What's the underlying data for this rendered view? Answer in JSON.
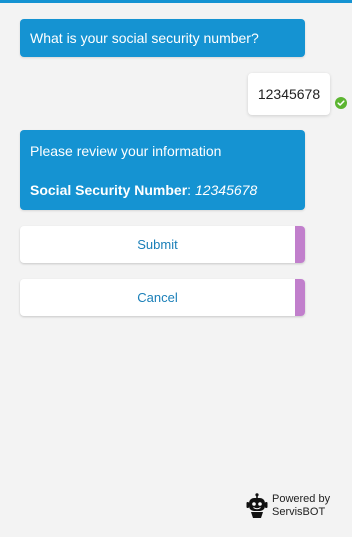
{
  "chat": {
    "bot_question": "What is your social security number?",
    "user_reply": "12345678",
    "review": {
      "title": "Please review your information",
      "field_label": "Social Security Number",
      "field_separator": ":",
      "field_value": "12345678"
    }
  },
  "actions": {
    "submit_label": "Submit",
    "cancel_label": "Cancel"
  },
  "branding": {
    "powered_line1": "Powered by",
    "powered_line2": "ServisBOT",
    "logo_icon": "robot-icon"
  },
  "colors": {
    "bot_bubble": "#1593d2",
    "button_accent": "#c17fcc",
    "button_text": "#1a7fb8",
    "delivered_check": "#5cb531",
    "background": "#f3f3f3"
  },
  "icons": {
    "delivered": "check-circle-icon"
  }
}
